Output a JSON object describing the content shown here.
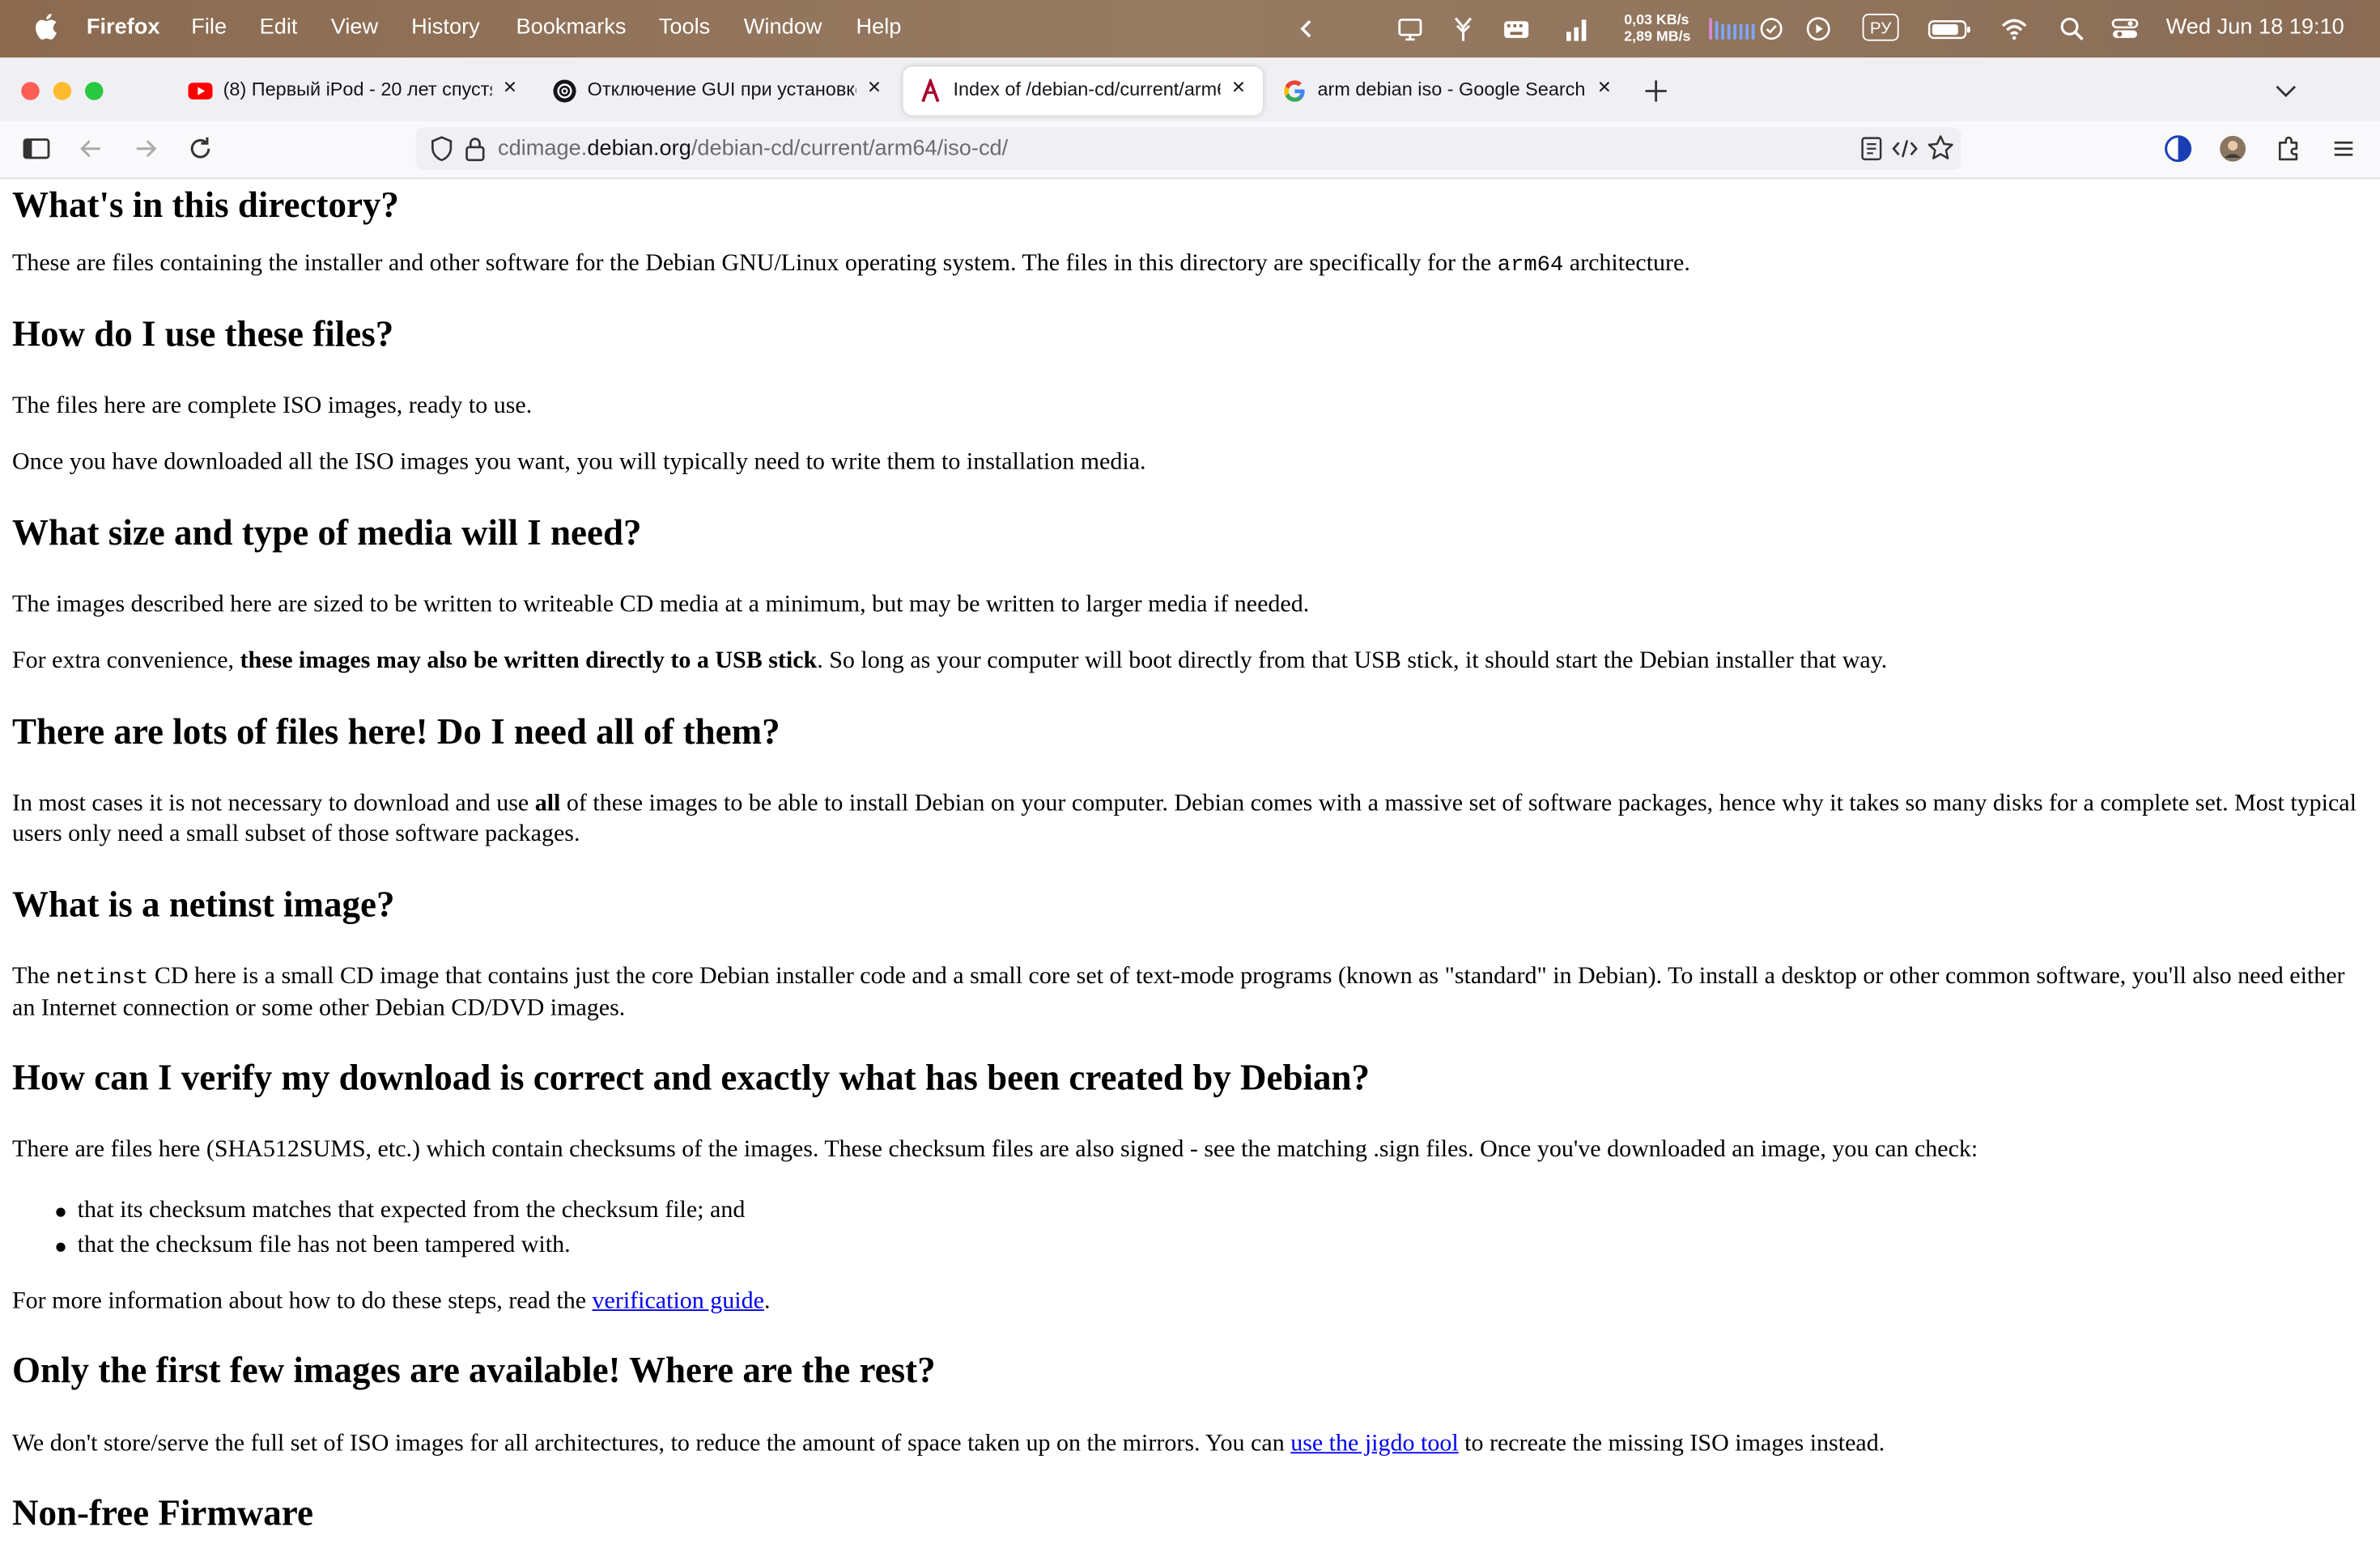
{
  "menubar": {
    "app": "Firefox",
    "items": [
      "File",
      "Edit",
      "View",
      "History",
      "Bookmarks",
      "Tools",
      "Window",
      "Help"
    ],
    "net_up": "0,03 KB/s",
    "net_down": "2,89 MB/s",
    "input_source": "РУ",
    "datetime": "Wed Jun 18  19:10"
  },
  "tabs": [
    {
      "title": "(8) Первый iPod - 20 лет спустя",
      "favicon": "youtube-icon"
    },
    {
      "title": "Отключение GUI при установке",
      "favicon": "chatgpt-icon"
    },
    {
      "title": "Index of /debian-cd/current/arm64",
      "favicon": "debian-icon",
      "active": true
    },
    {
      "title": "arm debian iso - Google Search",
      "favicon": "google-icon"
    }
  ],
  "urlbar": {
    "prefix": "cdimage.",
    "host": "debian.org",
    "path": "/debian-cd/current/arm64/iso-cd/"
  },
  "content": {
    "h1": "What's in this directory?",
    "p1a": "These are files containing the installer and other software for the Debian GNU/Linux operating system. The files in this directory are specifically for the ",
    "p1code": "arm64",
    "p1b": " architecture.",
    "h2": "How do I use these files?",
    "p2": "The files here are complete ISO images, ready to use.",
    "p3": "Once you have downloaded all the ISO images you want, you will typically need to write them to installation media.",
    "h3": "What size and type of media will I need?",
    "p4": "The images described here are sized to be written to writeable CD media at a minimum, but may be written to larger media if needed.",
    "p5a": "For extra convenience, ",
    "p5b": "these images may also be written directly to a USB stick",
    "p5c": ". So long as your computer will boot directly from that USB stick, it should start the Debian installer that way.",
    "h4": "There are lots of files here! Do I need all of them?",
    "p6a": "In most cases it is not necessary to download and use ",
    "p6b": "all",
    "p6c": " of these images to be able to install Debian on your computer. Debian comes with a massive set of software packages, hence why it takes so many disks for a complete set. Most typical users only need a small subset of those software packages.",
    "h5": "What is a netinst image?",
    "p7a": "The ",
    "p7code": "netinst",
    "p7b": " CD here is a small CD image that contains just the core Debian installer code and a small core set of text-mode programs (known as \"standard\" in Debian). To install a desktop or other common software, you'll also need either an Internet connection or some other Debian CD/DVD images.",
    "h6": "How can I verify my download is correct and exactly what has been created by Debian?",
    "p8": "There are files here (SHA512SUMS, etc.) which contain checksums of the images. These checksum files are also signed - see the matching .sign files. Once you've downloaded an image, you can check:",
    "li1": "that its checksum matches that expected from the checksum file; and",
    "li2": "that the checksum file has not been tampered with.",
    "p9a": "For more information about how to do these steps, read the ",
    "p9link": "verification guide",
    "p9b": ".",
    "h7": "Only the first few images are available! Where are the rest?",
    "p10a": "We don't store/serve the full set of ISO images for all architectures, to reduce the amount of space taken up on the mirrors. You can ",
    "p10link": "use the jigdo tool",
    "p10b": " to recreate the missing ISO images instead.",
    "h8": "Non-free Firmware"
  }
}
